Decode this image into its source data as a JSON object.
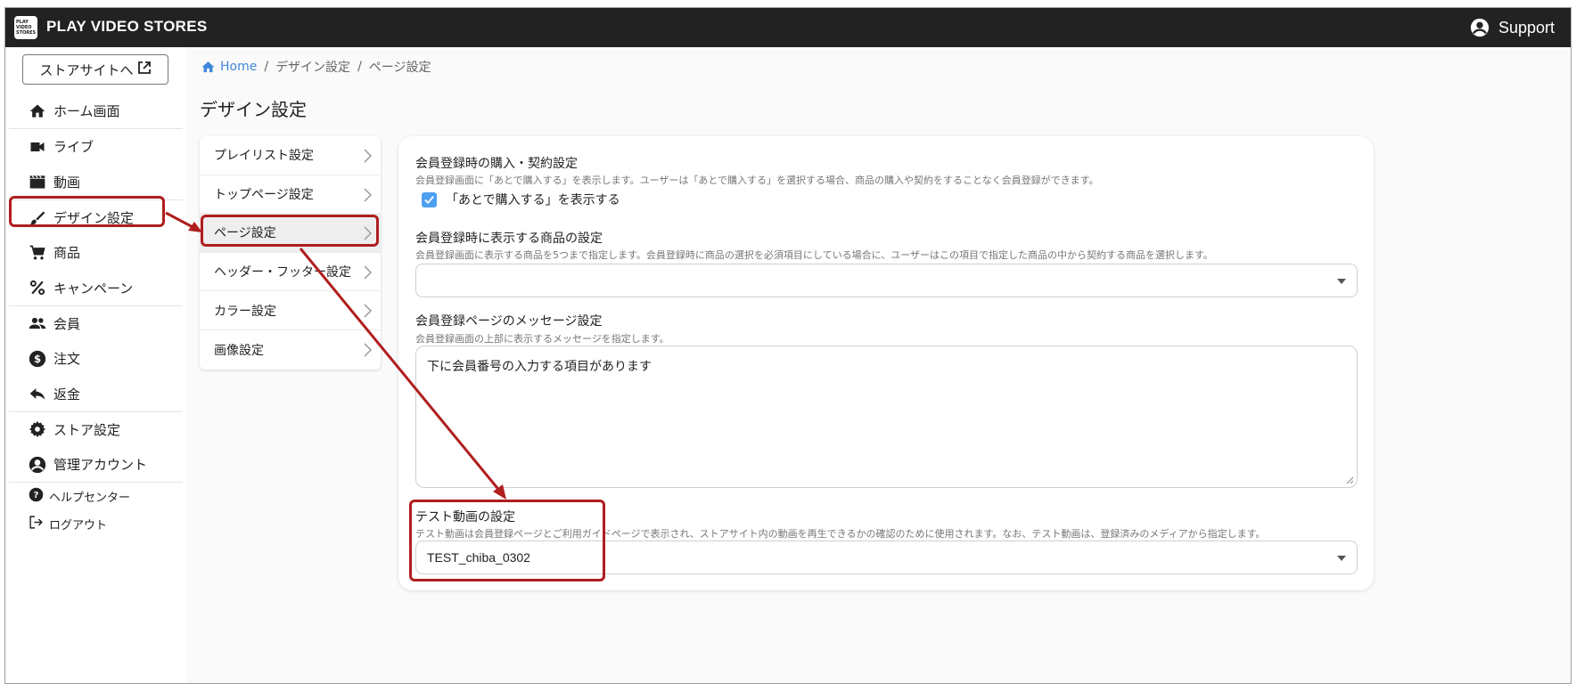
{
  "app": {
    "title": "PLAY VIDEO STORES",
    "logo_text": "PLAY VIDEO STORES",
    "support_label": "Support"
  },
  "sidebar": {
    "store_button": "ストアサイトへ",
    "items": [
      {
        "label": "ホーム画面",
        "icon": "home-icon"
      },
      {
        "label": "ライブ",
        "icon": "video-camera-icon"
      },
      {
        "label": "動画",
        "icon": "clapperboard-icon"
      },
      {
        "label": "デザイン設定",
        "icon": "brush-icon"
      },
      {
        "label": "商品",
        "icon": "cart-icon"
      },
      {
        "label": "キャンペーン",
        "icon": "percent-icon"
      },
      {
        "label": "会員",
        "icon": "people-icon"
      },
      {
        "label": "注文",
        "icon": "dollar-icon"
      },
      {
        "label": "返金",
        "icon": "reply-icon"
      },
      {
        "label": "ストア設定",
        "icon": "gear-icon"
      },
      {
        "label": "管理アカウント",
        "icon": "account-icon"
      }
    ],
    "footer": [
      {
        "label": "ヘルプセンター",
        "icon": "help-icon"
      },
      {
        "label": "ログアウト",
        "icon": "logout-icon"
      }
    ]
  },
  "breadcrumb": {
    "home": "Home",
    "sep": "/",
    "level1": "デザイン設定",
    "level2": "ページ設定"
  },
  "page_title": "デザイン設定",
  "submenu": {
    "items": [
      {
        "label": "プレイリスト設定"
      },
      {
        "label": "トップページ設定"
      },
      {
        "label": "ページ設定"
      },
      {
        "label": "ヘッダー・フッター設定"
      },
      {
        "label": "カラー設定"
      },
      {
        "label": "画像設定"
      }
    ]
  },
  "panel": {
    "purchase": {
      "title": "会員登録時の購入・契約設定",
      "desc": "会員登録画面に「あとで購入する」を表示します。ユーザーは「あとで購入する」を選択する場合、商品の購入や契約をすることなく会員登録ができます。",
      "checkbox_label": "「あとで購入する」を表示する",
      "checked": true
    },
    "products": {
      "title": "会員登録時に表示する商品の設定",
      "desc": "会員登録画面に表示する商品を5つまで指定します。会員登録時に商品の選択を必須項目にしている場合に、ユーザーはこの項目で指定した商品の中から契約する商品を選択します。",
      "value": ""
    },
    "message": {
      "title": "会員登録ページのメッセージ設定",
      "desc": "会員登録画面の上部に表示するメッセージを指定します。",
      "value": "下に会員番号の入力する項目があります"
    },
    "test_video": {
      "title": "テスト動画の設定",
      "desc": "テスト動画は会員登録ページとご利用ガイドページで表示され、ストアサイト内の動画を再生できるかの確認のために使用されます。なお、テスト動画は、登録済みのメディアから指定します。",
      "value": "TEST_chiba_0302"
    }
  },
  "colors": {
    "topbar": "#222222",
    "accent": "#3f88d8",
    "checkbox": "#4f9ff0",
    "annotation": "#b01e1e"
  }
}
